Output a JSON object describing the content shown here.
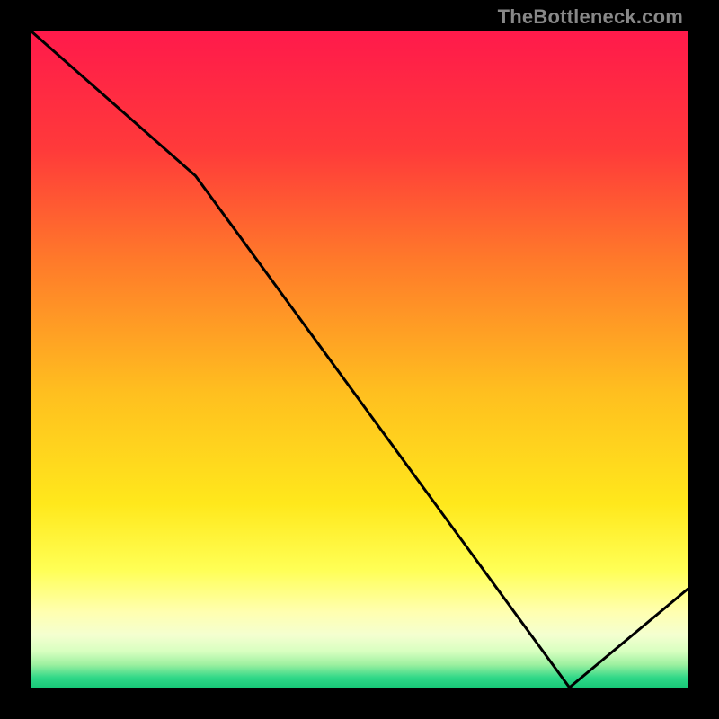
{
  "watermark": "TheBottleneck.com",
  "chart_data": {
    "type": "line",
    "title": "",
    "xlabel": "",
    "ylabel": "",
    "xlim": [
      0,
      100
    ],
    "ylim": [
      0,
      100
    ],
    "series": [
      {
        "name": "bottleneck-curve",
        "x": [
          0,
          25,
          82,
          100
        ],
        "y": [
          100,
          78,
          0,
          15
        ]
      }
    ],
    "annotations": [
      {
        "text": "",
        "x": 82,
        "y": 0,
        "name": "optimal-marker"
      }
    ],
    "background_gradient": {
      "stops": [
        {
          "pos": 0.0,
          "color": "#ff1a4b"
        },
        {
          "pos": 0.18,
          "color": "#ff3a3a"
        },
        {
          "pos": 0.35,
          "color": "#ff7a2a"
        },
        {
          "pos": 0.55,
          "color": "#ffbf1f"
        },
        {
          "pos": 0.72,
          "color": "#ffe81c"
        },
        {
          "pos": 0.82,
          "color": "#ffff55"
        },
        {
          "pos": 0.885,
          "color": "#ffffb0"
        },
        {
          "pos": 0.92,
          "color": "#f4ffd0"
        },
        {
          "pos": 0.945,
          "color": "#d8ffc0"
        },
        {
          "pos": 0.965,
          "color": "#9df0a0"
        },
        {
          "pos": 0.985,
          "color": "#30d888"
        },
        {
          "pos": 1.0,
          "color": "#18c878"
        }
      ]
    }
  }
}
